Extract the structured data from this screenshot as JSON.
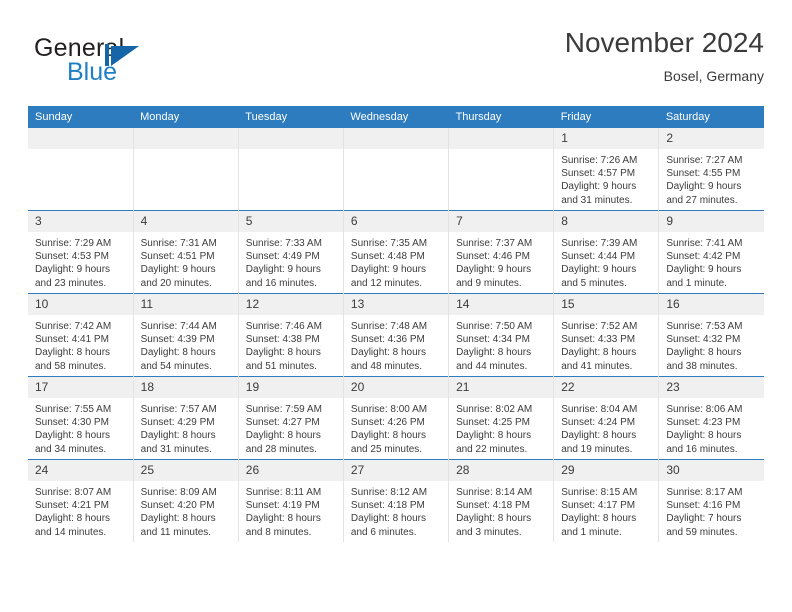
{
  "brand": {
    "name_part1": "General",
    "name_part2": "Blue",
    "logo_icon": "triangle-flag-icon"
  },
  "header": {
    "title": "November 2024",
    "location": "Bosel, Germany"
  },
  "weekday_headers": [
    "Sunday",
    "Monday",
    "Tuesday",
    "Wednesday",
    "Thursday",
    "Friday",
    "Saturday"
  ],
  "colors": {
    "header_blue": "#2e7cc0",
    "brand_blue": "#1f7fc4",
    "daynum_background": "#f0f0f0",
    "text": "#3c3c3c"
  },
  "weeks": [
    [
      {
        "day": "",
        "sunrise": "",
        "sunset": "",
        "daylight_line1": "",
        "daylight_line2": ""
      },
      {
        "day": "",
        "sunrise": "",
        "sunset": "",
        "daylight_line1": "",
        "daylight_line2": ""
      },
      {
        "day": "",
        "sunrise": "",
        "sunset": "",
        "daylight_line1": "",
        "daylight_line2": ""
      },
      {
        "day": "",
        "sunrise": "",
        "sunset": "",
        "daylight_line1": "",
        "daylight_line2": ""
      },
      {
        "day": "",
        "sunrise": "",
        "sunset": "",
        "daylight_line1": "",
        "daylight_line2": ""
      },
      {
        "day": "1",
        "sunrise": "Sunrise: 7:26 AM",
        "sunset": "Sunset: 4:57 PM",
        "daylight_line1": "Daylight: 9 hours",
        "daylight_line2": "and 31 minutes."
      },
      {
        "day": "2",
        "sunrise": "Sunrise: 7:27 AM",
        "sunset": "Sunset: 4:55 PM",
        "daylight_line1": "Daylight: 9 hours",
        "daylight_line2": "and 27 minutes."
      }
    ],
    [
      {
        "day": "3",
        "sunrise": "Sunrise: 7:29 AM",
        "sunset": "Sunset: 4:53 PM",
        "daylight_line1": "Daylight: 9 hours",
        "daylight_line2": "and 23 minutes."
      },
      {
        "day": "4",
        "sunrise": "Sunrise: 7:31 AM",
        "sunset": "Sunset: 4:51 PM",
        "daylight_line1": "Daylight: 9 hours",
        "daylight_line2": "and 20 minutes."
      },
      {
        "day": "5",
        "sunrise": "Sunrise: 7:33 AM",
        "sunset": "Sunset: 4:49 PM",
        "daylight_line1": "Daylight: 9 hours",
        "daylight_line2": "and 16 minutes."
      },
      {
        "day": "6",
        "sunrise": "Sunrise: 7:35 AM",
        "sunset": "Sunset: 4:48 PM",
        "daylight_line1": "Daylight: 9 hours",
        "daylight_line2": "and 12 minutes."
      },
      {
        "day": "7",
        "sunrise": "Sunrise: 7:37 AM",
        "sunset": "Sunset: 4:46 PM",
        "daylight_line1": "Daylight: 9 hours",
        "daylight_line2": "and 9 minutes."
      },
      {
        "day": "8",
        "sunrise": "Sunrise: 7:39 AM",
        "sunset": "Sunset: 4:44 PM",
        "daylight_line1": "Daylight: 9 hours",
        "daylight_line2": "and 5 minutes."
      },
      {
        "day": "9",
        "sunrise": "Sunrise: 7:41 AM",
        "sunset": "Sunset: 4:42 PM",
        "daylight_line1": "Daylight: 9 hours",
        "daylight_line2": "and 1 minute."
      }
    ],
    [
      {
        "day": "10",
        "sunrise": "Sunrise: 7:42 AM",
        "sunset": "Sunset: 4:41 PM",
        "daylight_line1": "Daylight: 8 hours",
        "daylight_line2": "and 58 minutes."
      },
      {
        "day": "11",
        "sunrise": "Sunrise: 7:44 AM",
        "sunset": "Sunset: 4:39 PM",
        "daylight_line1": "Daylight: 8 hours",
        "daylight_line2": "and 54 minutes."
      },
      {
        "day": "12",
        "sunrise": "Sunrise: 7:46 AM",
        "sunset": "Sunset: 4:38 PM",
        "daylight_line1": "Daylight: 8 hours",
        "daylight_line2": "and 51 minutes."
      },
      {
        "day": "13",
        "sunrise": "Sunrise: 7:48 AM",
        "sunset": "Sunset: 4:36 PM",
        "daylight_line1": "Daylight: 8 hours",
        "daylight_line2": "and 48 minutes."
      },
      {
        "day": "14",
        "sunrise": "Sunrise: 7:50 AM",
        "sunset": "Sunset: 4:34 PM",
        "daylight_line1": "Daylight: 8 hours",
        "daylight_line2": "and 44 minutes."
      },
      {
        "day": "15",
        "sunrise": "Sunrise: 7:52 AM",
        "sunset": "Sunset: 4:33 PM",
        "daylight_line1": "Daylight: 8 hours",
        "daylight_line2": "and 41 minutes."
      },
      {
        "day": "16",
        "sunrise": "Sunrise: 7:53 AM",
        "sunset": "Sunset: 4:32 PM",
        "daylight_line1": "Daylight: 8 hours",
        "daylight_line2": "and 38 minutes."
      }
    ],
    [
      {
        "day": "17",
        "sunrise": "Sunrise: 7:55 AM",
        "sunset": "Sunset: 4:30 PM",
        "daylight_line1": "Daylight: 8 hours",
        "daylight_line2": "and 34 minutes."
      },
      {
        "day": "18",
        "sunrise": "Sunrise: 7:57 AM",
        "sunset": "Sunset: 4:29 PM",
        "daylight_line1": "Daylight: 8 hours",
        "daylight_line2": "and 31 minutes."
      },
      {
        "day": "19",
        "sunrise": "Sunrise: 7:59 AM",
        "sunset": "Sunset: 4:27 PM",
        "daylight_line1": "Daylight: 8 hours",
        "daylight_line2": "and 28 minutes."
      },
      {
        "day": "20",
        "sunrise": "Sunrise: 8:00 AM",
        "sunset": "Sunset: 4:26 PM",
        "daylight_line1": "Daylight: 8 hours",
        "daylight_line2": "and 25 minutes."
      },
      {
        "day": "21",
        "sunrise": "Sunrise: 8:02 AM",
        "sunset": "Sunset: 4:25 PM",
        "daylight_line1": "Daylight: 8 hours",
        "daylight_line2": "and 22 minutes."
      },
      {
        "day": "22",
        "sunrise": "Sunrise: 8:04 AM",
        "sunset": "Sunset: 4:24 PM",
        "daylight_line1": "Daylight: 8 hours",
        "daylight_line2": "and 19 minutes."
      },
      {
        "day": "23",
        "sunrise": "Sunrise: 8:06 AM",
        "sunset": "Sunset: 4:23 PM",
        "daylight_line1": "Daylight: 8 hours",
        "daylight_line2": "and 16 minutes."
      }
    ],
    [
      {
        "day": "24",
        "sunrise": "Sunrise: 8:07 AM",
        "sunset": "Sunset: 4:21 PM",
        "daylight_line1": "Daylight: 8 hours",
        "daylight_line2": "and 14 minutes."
      },
      {
        "day": "25",
        "sunrise": "Sunrise: 8:09 AM",
        "sunset": "Sunset: 4:20 PM",
        "daylight_line1": "Daylight: 8 hours",
        "daylight_line2": "and 11 minutes."
      },
      {
        "day": "26",
        "sunrise": "Sunrise: 8:11 AM",
        "sunset": "Sunset: 4:19 PM",
        "daylight_line1": "Daylight: 8 hours",
        "daylight_line2": "and 8 minutes."
      },
      {
        "day": "27",
        "sunrise": "Sunrise: 8:12 AM",
        "sunset": "Sunset: 4:18 PM",
        "daylight_line1": "Daylight: 8 hours",
        "daylight_line2": "and 6 minutes."
      },
      {
        "day": "28",
        "sunrise": "Sunrise: 8:14 AM",
        "sunset": "Sunset: 4:18 PM",
        "daylight_line1": "Daylight: 8 hours",
        "daylight_line2": "and 3 minutes."
      },
      {
        "day": "29",
        "sunrise": "Sunrise: 8:15 AM",
        "sunset": "Sunset: 4:17 PM",
        "daylight_line1": "Daylight: 8 hours",
        "daylight_line2": "and 1 minute."
      },
      {
        "day": "30",
        "sunrise": "Sunrise: 8:17 AM",
        "sunset": "Sunset: 4:16 PM",
        "daylight_line1": "Daylight: 7 hours",
        "daylight_line2": "and 59 minutes."
      }
    ]
  ]
}
